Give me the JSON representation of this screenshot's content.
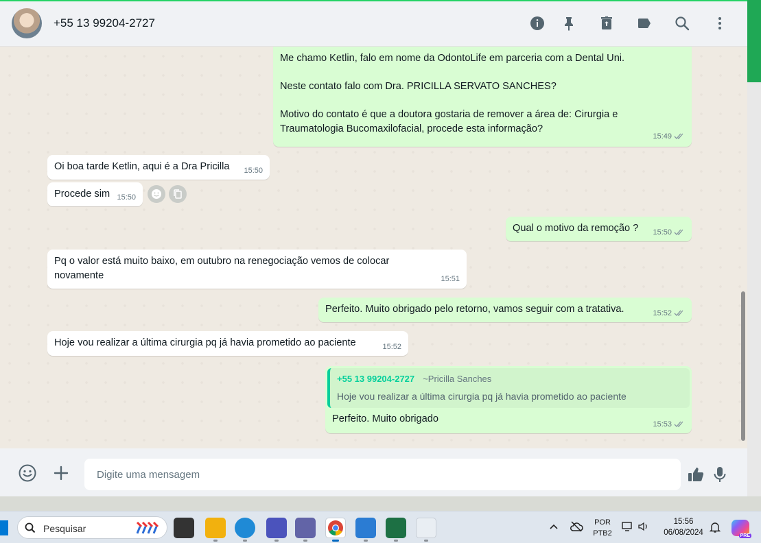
{
  "header": {
    "contact": "+55 13 99204-2727",
    "icons": [
      "info-icon",
      "pin-icon",
      "archive-icon",
      "label-icon",
      "search-icon",
      "more-vertical-icon"
    ]
  },
  "messages": [
    {
      "dir": "out",
      "text": "Me chamo Ketlin, falo em nome da OdontoLife em parceria com a Dental Uni.\n\nNeste contato falo com Dra. PRICILLA SERVATO SANCHES?\n\nMotivo do contato é que a doutora gostaria de remover a área de: Cirurgia e\nTraumatologia Bucomaxilofacial, procede esta informação?",
      "time": "15:49"
    },
    {
      "dir": "in",
      "text": "Oi boa tarde Ketlin, aqui é a Dra Pricilla",
      "time": "15:50"
    },
    {
      "dir": "in",
      "text": "Procede sim",
      "time": "15:50"
    },
    {
      "dir": "out",
      "text": "Qual o motivo da remoção ?",
      "time": "15:50"
    },
    {
      "dir": "in",
      "text": "Pq o valor está muito baixo, em outubro na renegociação vemos de colocar\nnovamente",
      "time": "15:51"
    },
    {
      "dir": "out",
      "text": "Perfeito. Muito obrigado pelo retorno, vamos seguir com a tratativa.",
      "time": "15:52"
    },
    {
      "dir": "in",
      "text": "Hoje vou realizar a última cirurgia pq já havia prometido ao paciente",
      "time": "15:52"
    },
    {
      "dir": "out",
      "quote": {
        "author": "+55 13 99204-2727",
        "alias": "~Pricilla Sanches",
        "text": "Hoje vou realizar a última cirurgia pq já havia prometido ao paciente"
      },
      "text": "Perfeito. Muito obrigado",
      "time": "15:53"
    }
  ],
  "composer": {
    "placeholder": "Digite uma mensagem",
    "icons": [
      "emoji-icon",
      "plus-icon",
      "thumbs-up-icon",
      "microphone-icon"
    ]
  },
  "taskbar": {
    "search_label": "Pesquisar",
    "apps": [
      "task-view",
      "file-explorer",
      "edge",
      "teams-classic",
      "teams",
      "chrome",
      "notepad",
      "excel",
      "snipping-tool"
    ],
    "lang_top": "POR",
    "lang_bottom": "PTB2",
    "time": "15:56",
    "date": "06/08/2024",
    "copilot_badge": "PRE"
  },
  "colors": {
    "outgoing_bubble": "#d9fdd3",
    "incoming_bubble": "#ffffff",
    "chat_bg": "#efeae2",
    "accent": "#06cf9c",
    "ticks": "#8696a0"
  }
}
